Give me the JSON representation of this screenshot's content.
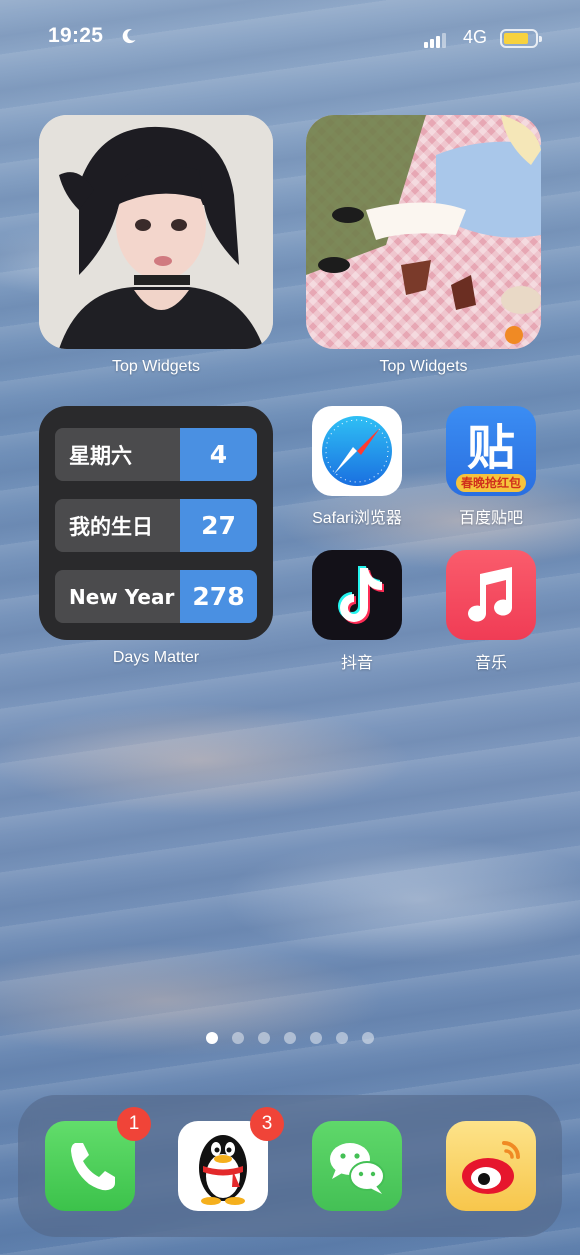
{
  "status_bar": {
    "time": "19:25",
    "network": "4G",
    "icons": [
      "moon-icon",
      "signal-icon",
      "battery-icon"
    ],
    "battery_color": "#f7d23e"
  },
  "widgets": {
    "photo_left_label": "Top Widgets",
    "photo_right_label": "Top Widgets",
    "days_matter": {
      "label": "Days Matter",
      "rows": [
        {
          "name": "星期六",
          "days": "4"
        },
        {
          "name": "我的生日",
          "days": "27"
        },
        {
          "name": "New Year",
          "days": "278"
        }
      ],
      "accent_color": "#4a90e2"
    }
  },
  "apps": {
    "safari": "Safari浏览器",
    "tieba": "百度贴吧",
    "tieba_glyph": "贴",
    "tieba_banner": "春晚抢红包",
    "douyin": "抖音",
    "music": "音乐"
  },
  "page_indicator": {
    "count": 7,
    "active_index": 0
  },
  "dock": {
    "apps": [
      {
        "name": "phone",
        "badge": "1"
      },
      {
        "name": "qq",
        "badge": "3"
      },
      {
        "name": "wechat",
        "badge": ""
      },
      {
        "name": "weibo",
        "badge": ""
      }
    ]
  }
}
